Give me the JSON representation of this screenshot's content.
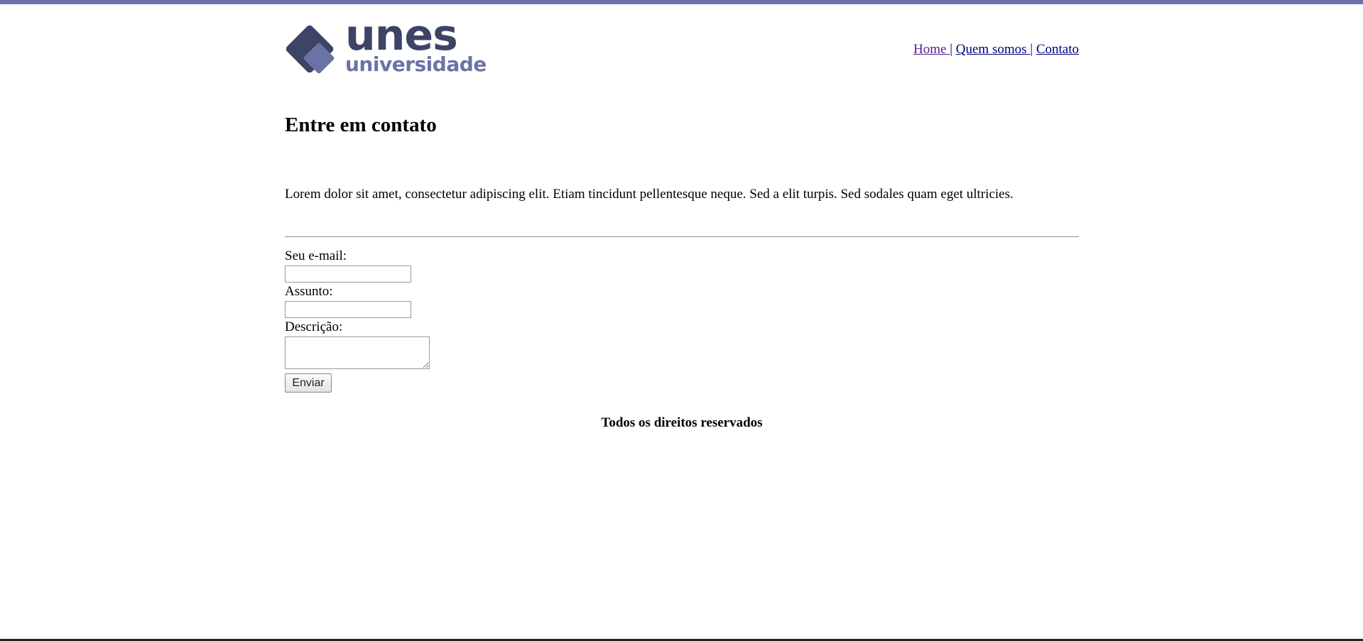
{
  "colors": {
    "top_bar": "#6b73a6",
    "logo_dark": "#3d4466",
    "logo_light": "#6b73a6",
    "link": "#00007f",
    "link_visited": "#551a8b"
  },
  "logo": {
    "word": "unes",
    "subtitle": "universidade",
    "icon": "diamond-logo-icon"
  },
  "nav": {
    "items": [
      {
        "label": "Home "
      },
      {
        "label": "Quem somos "
      },
      {
        "label": "Contato"
      }
    ],
    "separator": "|"
  },
  "page": {
    "title": "Entre em contato",
    "intro": "Lorem dolor sit amet, consectetur adipiscing elit. Etiam tincidunt pellentesque neque. Sed a elit turpis. Sed sodales quam eget ultricies."
  },
  "form": {
    "email_label": "Seu e-mail:",
    "email_value": "",
    "subject_label": "Assunto:",
    "subject_value": "",
    "description_label": "Descrição:",
    "description_value": "",
    "submit_label": "Enviar"
  },
  "footer": {
    "text": "Todos os direitos reservados"
  }
}
